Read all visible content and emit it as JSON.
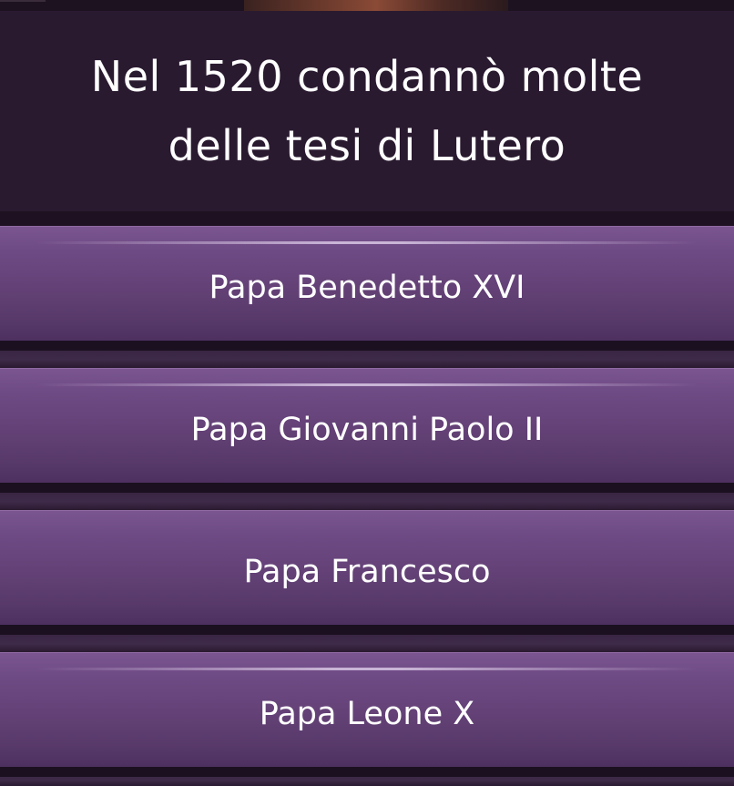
{
  "question": {
    "line1": "Nel 1520 condannò molte",
    "line2": "delle tesi di Lutero"
  },
  "answers": [
    {
      "label": "Papa Benedetto XVI"
    },
    {
      "label": "Papa Giovanni Paolo II"
    },
    {
      "label": "Papa Francesco"
    },
    {
      "label": "Papa Leone X"
    }
  ],
  "colors": {
    "background": "#221427",
    "question_panel": "#2a1a30",
    "answer_button": "#6a4780",
    "text": "#ffffff"
  }
}
